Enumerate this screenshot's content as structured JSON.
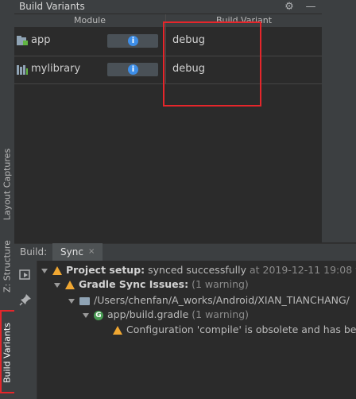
{
  "build_variants_panel": {
    "title": "Build Variants",
    "settings_icon": "gear-icon",
    "hide_icon": "minimize-icon",
    "columns": {
      "module": "Module",
      "build_variant": "Build Variant"
    },
    "rows": [
      {
        "module": "app",
        "icon": "app-module-icon",
        "variant": "debug",
        "info_icon": "info-icon"
      },
      {
        "module": "mylibrary",
        "icon": "library-module-icon",
        "variant": "debug",
        "info_icon": "info-icon"
      }
    ]
  },
  "left_tool_strip": {
    "tabs": [
      {
        "label": "Layout Captures",
        "icon": "layout-captures-icon"
      },
      {
        "label": "Z: Structure",
        "icon": "structure-icon"
      },
      {
        "label": "Build Variants",
        "icon": "build-variants-icon",
        "active": true
      }
    ]
  },
  "build_window": {
    "label": "Build:",
    "active_tab": "Sync",
    "close_glyph": "×",
    "toolbar_icons": [
      "rerun-icon",
      "pin-icon"
    ],
    "tree": [
      {
        "bold": "Project setup:",
        "text": " synced successfully",
        "muted": " at 2019-12-11 19:08",
        "trail": " w"
      },
      {
        "bold": "Gradle Sync Issues:",
        "muted": "(1 warning)"
      },
      {
        "text": "/Users/chenfan/A_works/Android/XIAN_TIANCHANG/"
      },
      {
        "text": "app/build.gradle",
        "muted": "(1 warning)"
      },
      {
        "text": "Configuration 'compile' is obsolete and has bee"
      }
    ]
  },
  "colors": {
    "highlight_red": "#e5262b",
    "warning_orange": "#f0a732",
    "info_blue": "#3d8ee8",
    "gradle_green": "#499c54",
    "panel_bg": "#2b2b2b",
    "chrome_bg": "#3c3f41"
  }
}
